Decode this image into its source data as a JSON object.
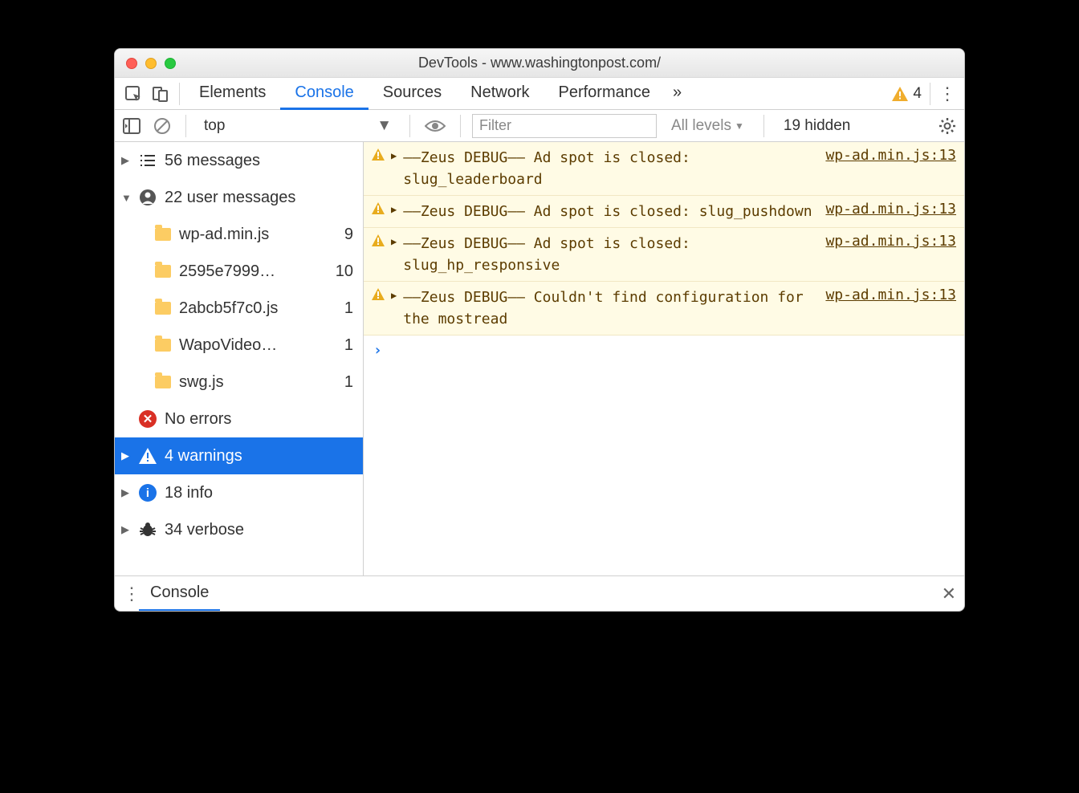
{
  "window": {
    "title": "DevTools - www.washingtonpost.com/"
  },
  "tabs": {
    "elements": "Elements",
    "console": "Console",
    "sources": "Sources",
    "network": "Network",
    "performance": "Performance",
    "more": "»",
    "warn_count": "4"
  },
  "toolbar": {
    "context": "top",
    "filter_placeholder": "Filter",
    "levels": "All levels",
    "hidden": "19 hidden"
  },
  "sidebar": {
    "messages": "56 messages",
    "user_messages": "22 user messages",
    "files": [
      {
        "name": "wp-ad.min.js",
        "count": "9"
      },
      {
        "name": "2595e7999…",
        "count": "10"
      },
      {
        "name": "2abcb5f7c0.js",
        "count": "1"
      },
      {
        "name": "WapoVideo…",
        "count": "1"
      },
      {
        "name": "swg.js",
        "count": "1"
      }
    ],
    "no_errors": "No errors",
    "warnings": "4 warnings",
    "info": "18 info",
    "verbose": "34 verbose"
  },
  "logs": [
    {
      "msg": "——Zeus DEBUG—— Ad spot is closed: slug_leaderboard",
      "src": "wp-ad.min.js:13"
    },
    {
      "msg": "——Zeus DEBUG—— Ad spot is closed: slug_pushdown",
      "src": "wp-ad.min.js:13"
    },
    {
      "msg": "——Zeus DEBUG—— Ad spot is closed: slug_hp_responsive",
      "src": "wp-ad.min.js:13"
    },
    {
      "msg": "——Zeus DEBUG—— Couldn't find configuration for the mostread",
      "src": "wp-ad.min.js:13"
    }
  ],
  "drawer": {
    "label": "Console"
  }
}
